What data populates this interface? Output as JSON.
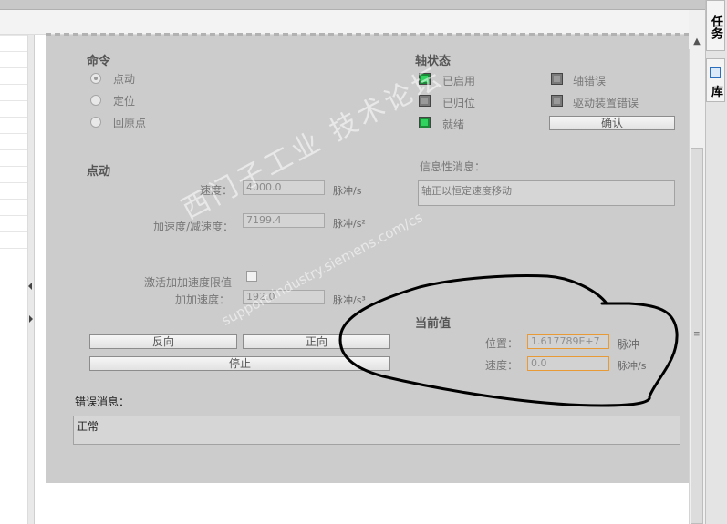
{
  "command": {
    "heading": "命令",
    "options": [
      {
        "label": "点动",
        "selected": true
      },
      {
        "label": "定位",
        "selected": false
      },
      {
        "label": "回原点",
        "selected": false
      }
    ]
  },
  "axis_status": {
    "heading": "轴状态",
    "enabled": {
      "label": "已启用",
      "state": "green"
    },
    "homed": {
      "label": "已归位",
      "state": "gray"
    },
    "ready": {
      "label": "就绪",
      "state": "green"
    },
    "axis_error": {
      "label": "轴错误",
      "state": "gray"
    },
    "drive_error": {
      "label": "驱动装置错误",
      "state": "gray"
    },
    "confirm_button": "确认"
  },
  "jog": {
    "heading": "点动",
    "speed_label": "速度：",
    "speed_value": "4000.0",
    "speed_unit": "脉冲/s",
    "accel_label": "加速度/减速度：",
    "accel_value": "7199.4",
    "accel_unit": "脉冲/s²",
    "jerk_enable_label": "激活加加速度限值",
    "jerk_label": "加加速度：",
    "jerk_value": "192.0",
    "jerk_unit": "脉冲/s³",
    "reverse_button": "反向",
    "forward_button": "正向",
    "stop_button": "停止"
  },
  "info": {
    "label": "信息性消息：",
    "message": "轴正以恒定速度移动"
  },
  "current": {
    "heading": "当前值",
    "position_label": "位置：",
    "position_value": "1.617789E+7",
    "position_unit": "脉冲",
    "velocity_label": "速度：",
    "velocity_value": "0.0",
    "velocity_unit": "脉冲/s"
  },
  "error": {
    "label": "错误消息：",
    "message": "正常"
  },
  "side_tabs": {
    "tasks": "任务",
    "library": "库"
  },
  "watermark": {
    "text": "西门子工业 技术论坛",
    "url": "support.industry.siemens.com/cs"
  },
  "colors": {
    "panel": "#cccccc",
    "led_green": "#2fd35d",
    "field_highlight": "#e89a36",
    "annotation": "#000000"
  }
}
